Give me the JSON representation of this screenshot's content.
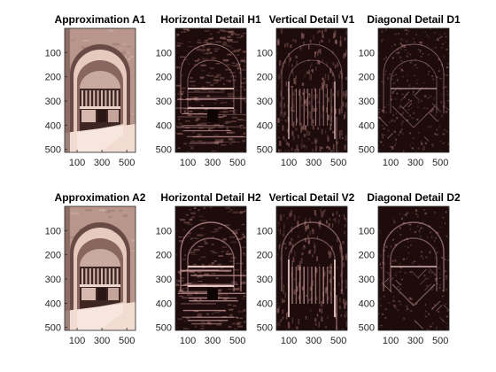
{
  "chart_data": {
    "type": "image-grid",
    "panels": [
      {
        "title": "Approximation A1",
        "kind": "approximation",
        "level": 1
      },
      {
        "title": "Horizontal Detail H1",
        "kind": "horizontal",
        "level": 1
      },
      {
        "title": "Vertical Detail V1",
        "kind": "vertical",
        "level": 1
      },
      {
        "title": "Diagonal Detail D1",
        "kind": "diagonal",
        "level": 1
      },
      {
        "title": "Approximation A2",
        "kind": "approximation",
        "level": 2
      },
      {
        "title": "Horizontal Detail H2",
        "kind": "horizontal",
        "level": 2
      },
      {
        "title": "Vertical Detail V2",
        "kind": "vertical",
        "level": 2
      },
      {
        "title": "Diagonal Detail D2",
        "kind": "diagonal",
        "level": 2
      }
    ],
    "x_ticks": [
      100,
      300,
      500
    ],
    "y_ticks": [
      100,
      200,
      300,
      400,
      500
    ],
    "xlim": [
      0,
      570
    ],
    "ylim": [
      0,
      512
    ],
    "colormap": "pink",
    "colors": {
      "detail_background": "#1e0c0c",
      "detail_edges": "#c89898",
      "approx_light": "#f2dcd2",
      "approx_dark": "#5a3a36"
    }
  }
}
